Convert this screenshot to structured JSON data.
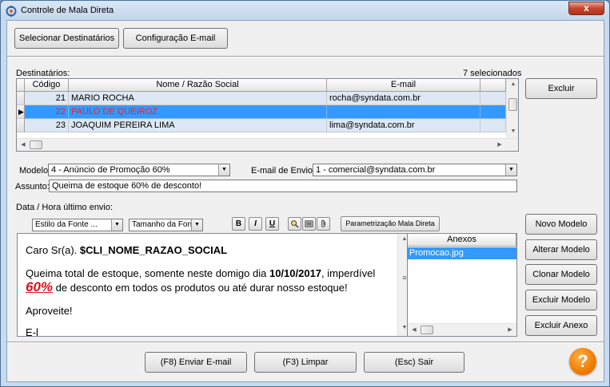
{
  "window": {
    "title": "Controle de Mala Direta",
    "close_label": "x"
  },
  "top_buttons": {
    "select_recipients": "Selecionar Destinatários",
    "email_config": "Configuração E-mail"
  },
  "recipients": {
    "label": "Destinatários:",
    "selected_count": "7 selecionados",
    "columns": [
      "Código",
      "Nome / Razão Social",
      "E-mail"
    ],
    "rows": [
      {
        "code": "21",
        "name": "MARIO ROCHA",
        "email": "rocha@syndata.com.br",
        "selected": false
      },
      {
        "code": "22",
        "name": "PAULO DE QUEIROZ",
        "email": "",
        "selected": true
      },
      {
        "code": "23",
        "name": "JOAQUIM PEREIRA LIMA",
        "email": "lima@syndata.com.br",
        "selected": false
      }
    ],
    "delete_label": "Excluir"
  },
  "form": {
    "model_label": "Modelo:",
    "model_value": "4 - Anúncio de Promoção 60%",
    "send_email_label": "E-mail de Envio:",
    "send_email_value": "1 - comercial@syndata.com.br",
    "subject_label": "Assunto:",
    "subject_value": "Queima de estoque 60% de desconto!",
    "last_send_label": "Data / Hora último envio:"
  },
  "toolbar": {
    "font_style": "Estilo da Fonte ...",
    "font_size": "Tamanho da Fonte...",
    "bold": "B",
    "italic": "I",
    "underline": "U",
    "mail_merge_params": "Parametrização Mala Direta"
  },
  "editor": {
    "greeting_prefix": "Caro Sr(a). ",
    "greeting_var": "$CLI_NOME_RAZAO_SOCIAL",
    "body_1": "Queima total de estoque, somente neste domigo dia ",
    "body_date": "10/10/2017",
    "body_2": ", imperdível ",
    "body_pct": "60%",
    "body_3": " de desconto em todos os produtos ou até durar nosso estoque!",
    "closing": "Aproveite!",
    "cut_line": "E-l"
  },
  "attachments": {
    "header": "Anexos",
    "items": [
      "Promocao.jpg"
    ]
  },
  "side_buttons": {
    "new_model": "Novo Modelo",
    "edit_model": "Alterar Modelo",
    "clone_model": "Clonar Modelo",
    "delete_model": "Excluir Modelo",
    "delete_attachment": "Excluir Anexo"
  },
  "bottom_buttons": {
    "send": "(F8) Enviar E-mail",
    "clear": "(F3) Limpar",
    "exit": "(Esc) Sair"
  },
  "help": {
    "label": "?"
  },
  "colors": {
    "accent": "#3399ff",
    "selected_row_text": "#ff1a1a",
    "highlight_pct": "#e0101c",
    "help_orange": "#f07c00"
  }
}
